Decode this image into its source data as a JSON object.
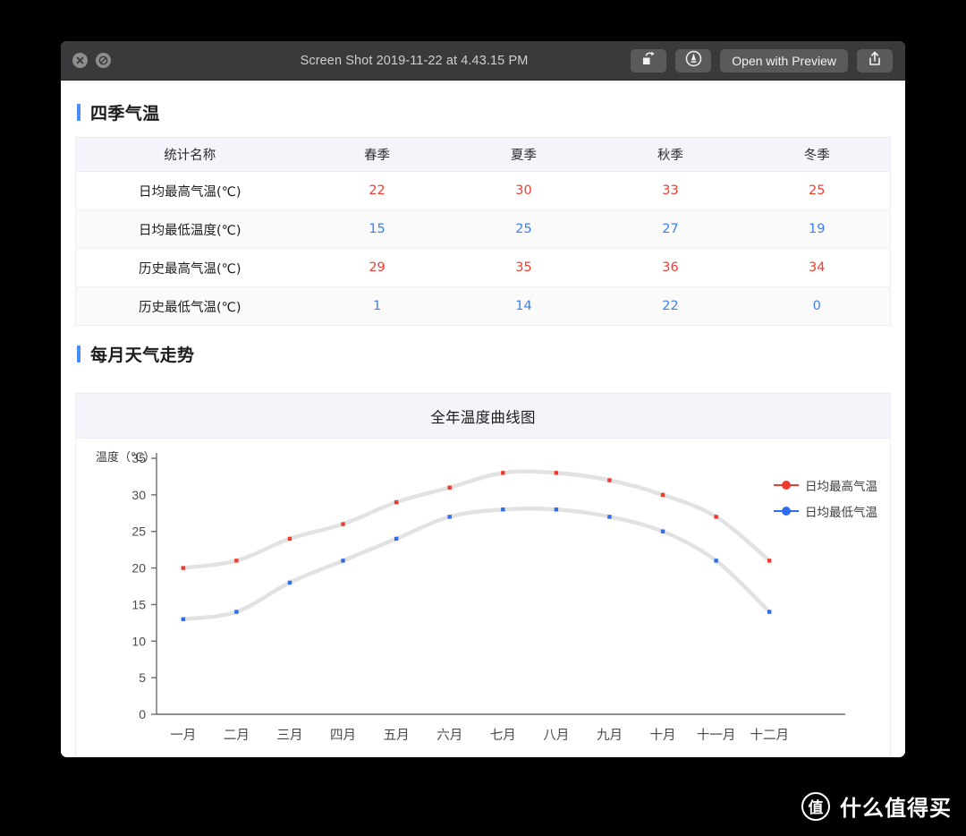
{
  "titlebar": {
    "filename": "Screen Shot 2019-11-22 at 4.43.15 PM",
    "close_icon": "close-x-icon",
    "markup_icon": "no-entry-icon",
    "rotate_label": "rotate-icon",
    "markup_tool_label": "markup-pen-icon",
    "open_button": "Open with Preview",
    "share_label": "share-icon"
  },
  "sections": {
    "seasons_title": "四季气温",
    "monthly_title": "每月天气走势"
  },
  "table": {
    "headers": [
      "统计名称",
      "春季",
      "夏季",
      "秋季",
      "冬季"
    ],
    "rows": [
      {
        "label": "日均最高气温(℃)",
        "kind": "high",
        "values": [
          "22",
          "30",
          "33",
          "25"
        ]
      },
      {
        "label": "日均最低温度(℃)",
        "kind": "low",
        "values": [
          "15",
          "25",
          "27",
          "19"
        ]
      },
      {
        "label": "历史最高气温(℃)",
        "kind": "high",
        "values": [
          "29",
          "35",
          "36",
          "34"
        ]
      },
      {
        "label": "历史最低气温(℃)",
        "kind": "low",
        "values": [
          "1",
          "14",
          "22",
          "0"
        ]
      }
    ]
  },
  "chart_data": {
    "type": "line",
    "title": "全年温度曲线图",
    "ylabel": "温度（℃）",
    "xlabel": "",
    "ylim": [
      0,
      35
    ],
    "yticks": [
      0,
      5,
      10,
      15,
      20,
      25,
      30,
      35
    ],
    "grid": false,
    "legend_position": "top-right",
    "categories": [
      "一月",
      "二月",
      "三月",
      "四月",
      "五月",
      "六月",
      "七月",
      "八月",
      "九月",
      "十月",
      "十一月",
      "十二月"
    ],
    "series": [
      {
        "name": "日均最高气温",
        "color": "#ee3b2f",
        "values": [
          20,
          21,
          24,
          26,
          29,
          31,
          33,
          33,
          32,
          30,
          27,
          21
        ]
      },
      {
        "name": "日均最低气温",
        "color": "#2f6dee",
        "values": [
          13,
          14,
          18,
          21,
          24,
          27,
          28,
          28,
          27,
          25,
          21,
          14
        ]
      }
    ],
    "line_color": "#e2e2e2",
    "axis_color": "#6b6b6b"
  },
  "watermark": {
    "badge": "值",
    "text": "什么值得买"
  }
}
